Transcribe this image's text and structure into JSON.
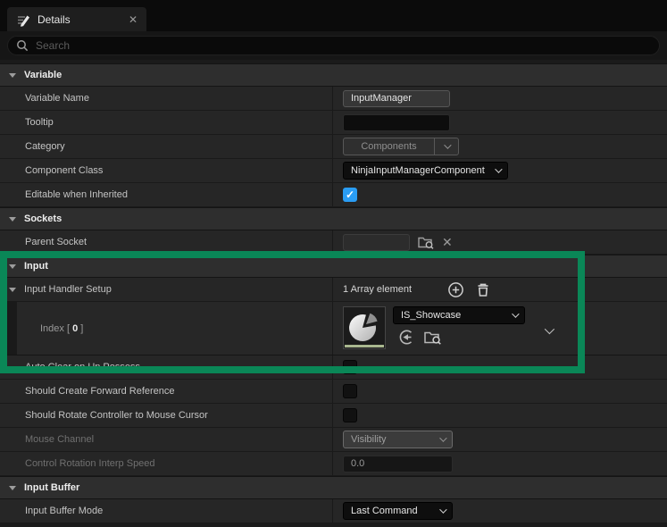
{
  "panel": {
    "tab_title": "Details"
  },
  "icons": {
    "close": "✕",
    "check": "✓",
    "clear": "✕"
  },
  "search": {
    "placeholder": "Search"
  },
  "colors": {
    "accent_blue": "#2a9df4",
    "highlight_green": "#0a8757",
    "asset_color_strip": "#a9b78f"
  },
  "sections": {
    "variable": {
      "title": "Variable"
    },
    "sockets": {
      "title": "Sockets"
    },
    "input": {
      "title": "Input"
    },
    "input_buffer": {
      "title": "Input Buffer"
    }
  },
  "rows": {
    "variable_name": {
      "label": "Variable Name",
      "value": "InputManager"
    },
    "tooltip": {
      "label": "Tooltip",
      "value": ""
    },
    "category": {
      "label": "Category",
      "value": "Components"
    },
    "component_class": {
      "label": "Component Class",
      "value": "NinjaInputManagerComponent"
    },
    "editable_when_inherited": {
      "label": "Editable when Inherited",
      "checked": true
    },
    "parent_socket": {
      "label": "Parent Socket",
      "value": ""
    },
    "input_handler_setup": {
      "label": "Input Handler Setup",
      "summary": "1 Array element"
    },
    "index0": {
      "label_prefix": "Index [ ",
      "index": "0",
      "label_suffix": " ]",
      "value": "IS_Showcase"
    },
    "auto_clear": {
      "label": "Auto Clear on Un Possess",
      "checked": false
    },
    "forward_reference": {
      "label": "Should Create Forward Reference",
      "checked": false
    },
    "rotate_controller": {
      "label": "Should Rotate Controller to Mouse Cursor",
      "checked": false
    },
    "mouse_channel": {
      "label": "Mouse Channel",
      "value": "Visibility",
      "disabled": true
    },
    "control_rotation": {
      "label": "Control Rotation Interp Speed",
      "value": "0.0",
      "disabled": true
    },
    "input_buffer_mode": {
      "label": "Input Buffer Mode",
      "value": "Last Command"
    }
  }
}
